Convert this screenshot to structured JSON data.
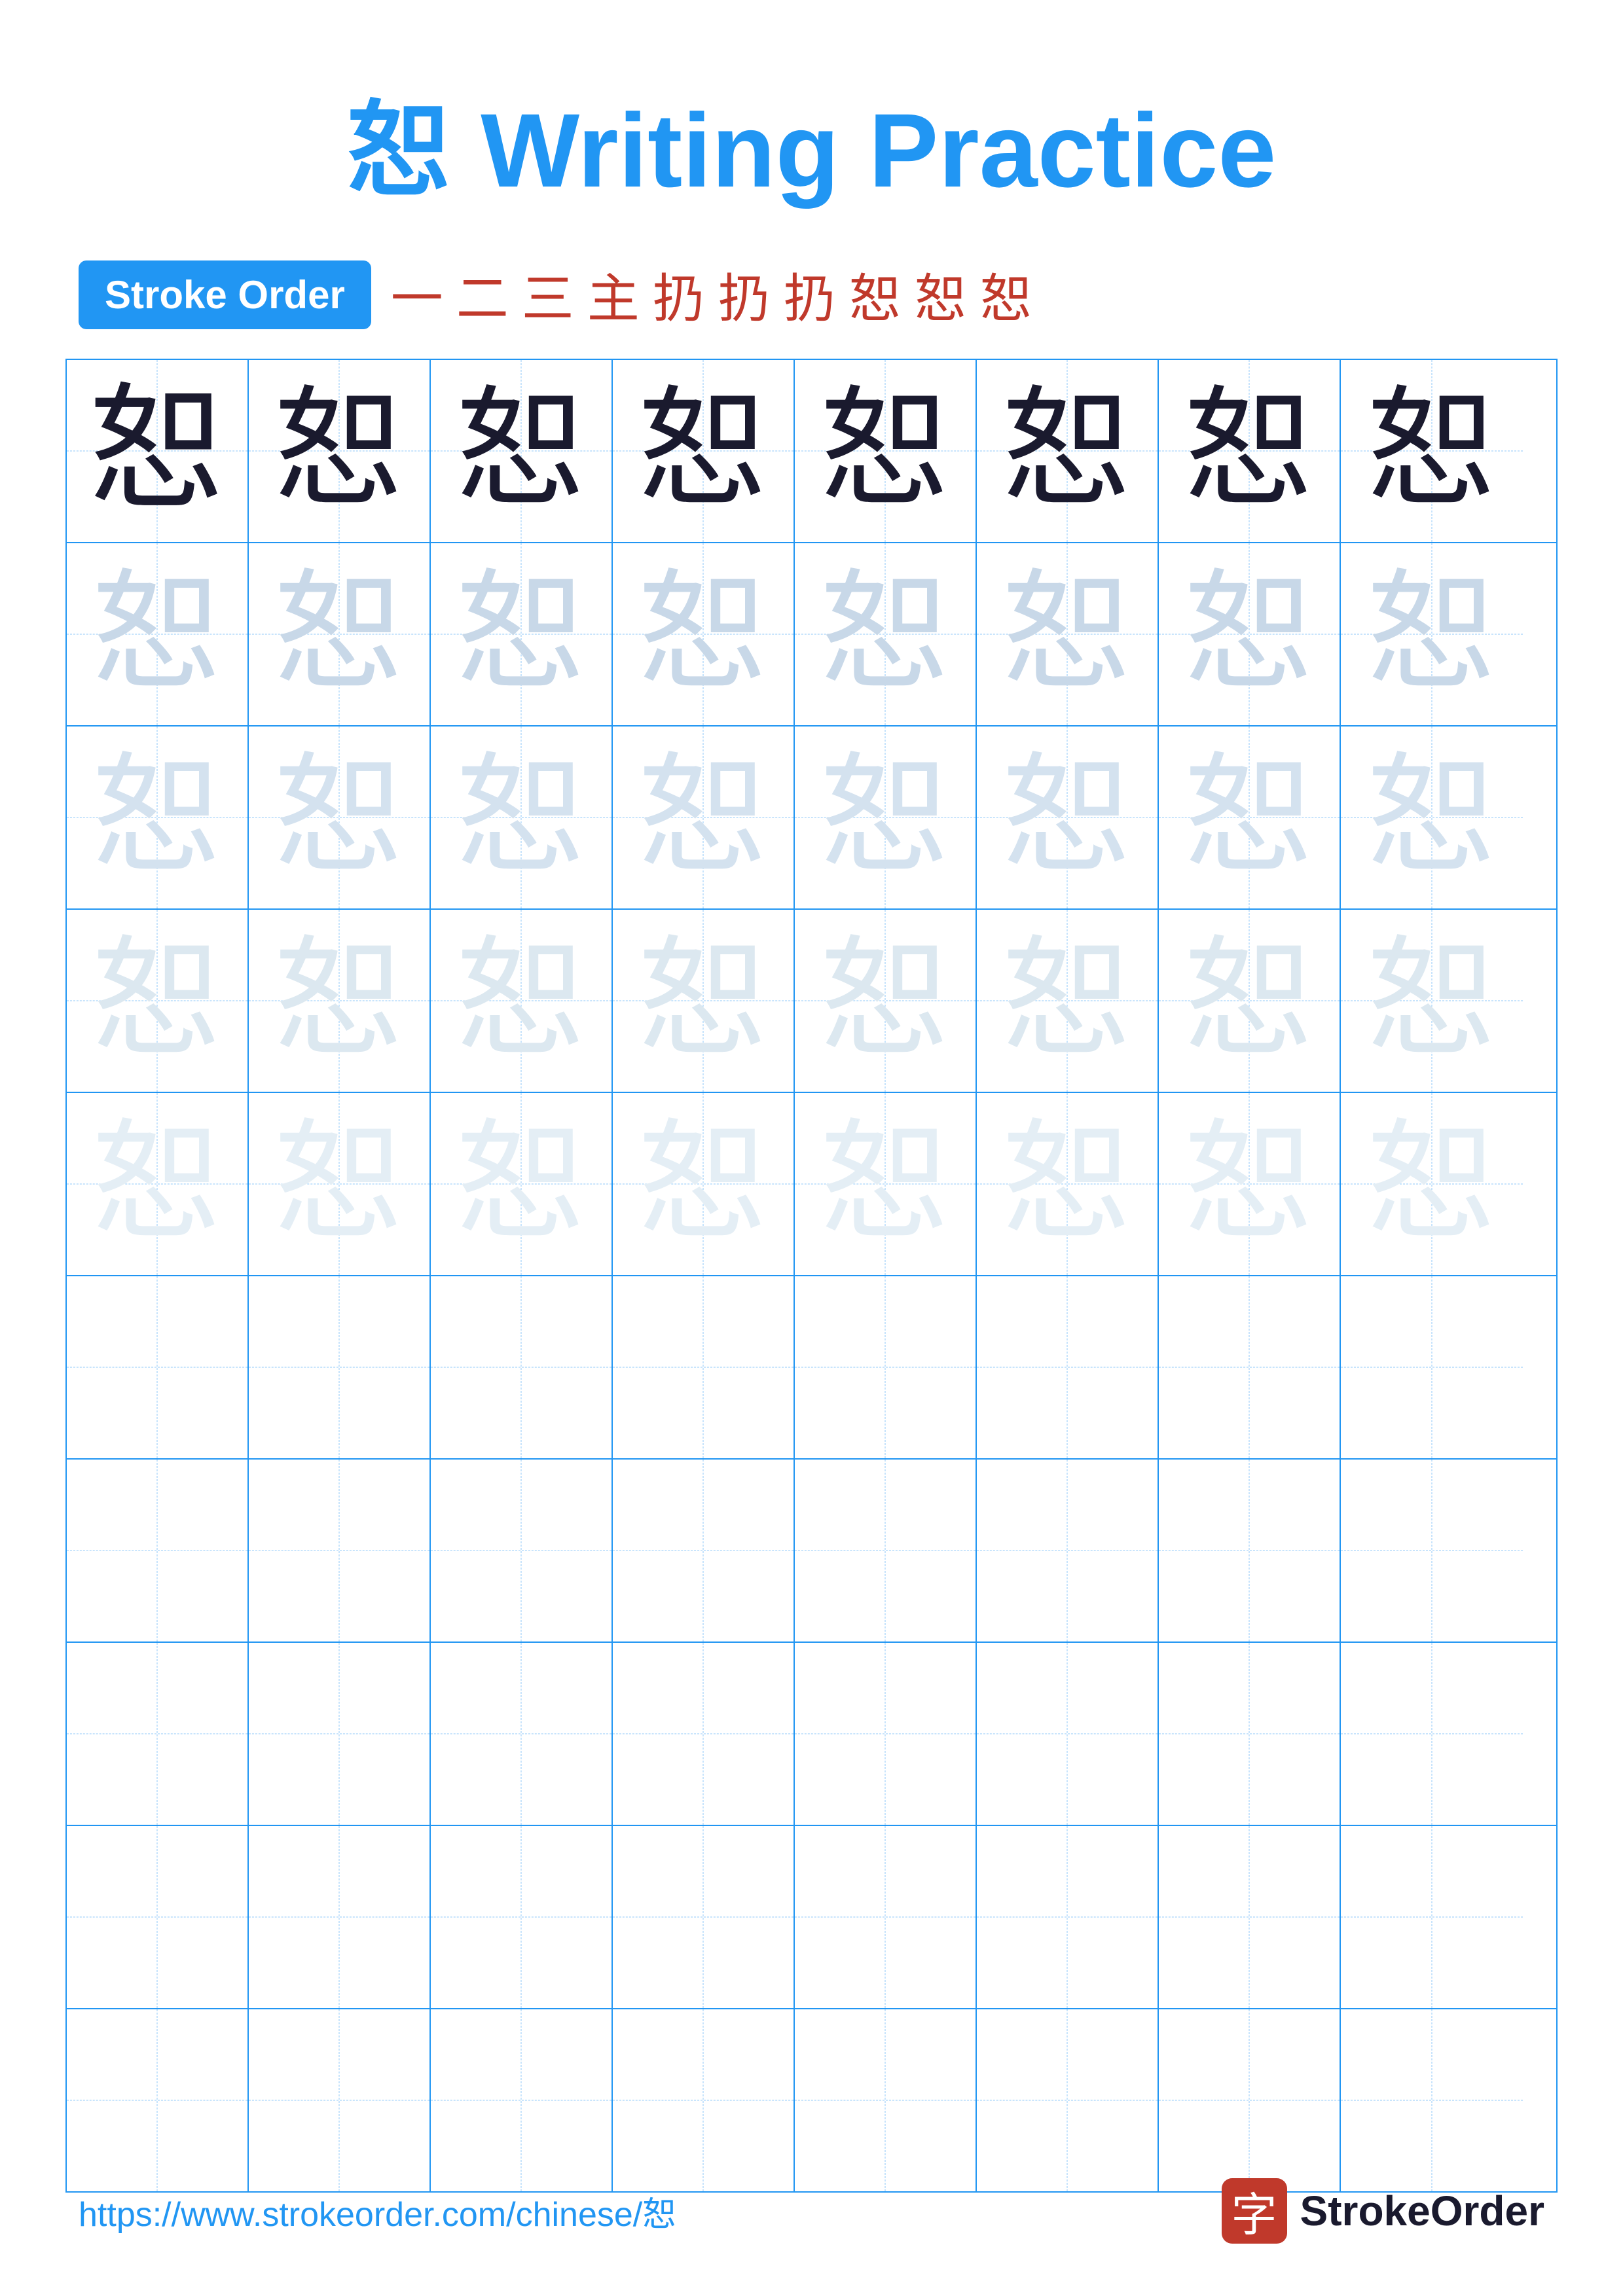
{
  "title": {
    "character": "恕",
    "label": "Writing Practice",
    "color": "#2196F3"
  },
  "stroke_order": {
    "badge_label": "Stroke Order",
    "strokes": [
      "一",
      "二",
      "三",
      "主",
      "扔",
      "扔",
      "扔",
      "恕",
      "恕",
      "恕"
    ]
  },
  "grid": {
    "character": "恕",
    "rows": 10,
    "cols": 8
  },
  "footer": {
    "url": "https://www.strokeorder.com/chinese/恕",
    "logo_text": "StrokeOrder",
    "logo_char": "字"
  }
}
